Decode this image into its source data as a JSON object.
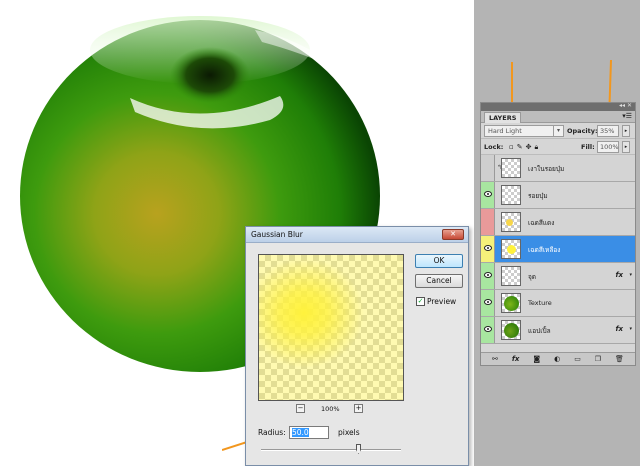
{
  "colors": {
    "apple_green": "#2f9a0d",
    "apple_dark": "#0b4f04",
    "apple_yellow": "#b49a1c",
    "highlight_yellow": "#fff23c",
    "selection_blue": "#3a8ee6",
    "arrow_orange": "#f2971e",
    "workspace_gray": "#b4b4b4"
  },
  "layers_panel": {
    "tab_label": "LAYERS",
    "blend_mode": "Hard Light",
    "opacity_label": "Opacity:",
    "opacity_value": "35%",
    "lock_label": "Lock:",
    "fill_label": "Fill:",
    "fill_value": "100%",
    "layers": [
      {
        "name": "เงาในรอยบุ๋ม",
        "color_tag": "#cfcfcf",
        "thumb": "empty",
        "has_fx": false,
        "selected": false
      },
      {
        "name": "รอยบุ๋ม",
        "color_tag": "#a8e6a0",
        "thumb": "empty",
        "has_fx": false,
        "selected": false
      },
      {
        "name": "เฉดสีแดง",
        "color_tag": "#e99a9a",
        "thumb": "yellow-dot",
        "has_fx": false,
        "selected": false
      },
      {
        "name": "เฉดสีเหลือง",
        "color_tag": "#f5f07a",
        "thumb": "yellow-dot",
        "has_fx": false,
        "selected": true
      },
      {
        "name": "จุด",
        "color_tag": "#a8e6a0",
        "thumb": "empty",
        "has_fx": true,
        "selected": false
      },
      {
        "name": "Texture",
        "color_tag": "#a8e6a0",
        "thumb": "green-apple",
        "has_fx": false,
        "selected": false
      },
      {
        "name": "แอปเปิ้ล",
        "color_tag": "#a8e6a0",
        "thumb": "green-apple",
        "has_fx": true,
        "selected": false
      }
    ],
    "fx_label": "fx",
    "bottom_icons": [
      "link-icon",
      "fx-icon",
      "mask-icon",
      "adjustment-icon",
      "folder-icon",
      "new-layer-icon",
      "trash-icon"
    ]
  },
  "dialog": {
    "title": "Gaussian Blur",
    "close_glyph": "✕",
    "ok_label": "OK",
    "cancel_label": "Cancel",
    "preview_label": "Preview",
    "preview_checked": true,
    "zoom_minus": "−",
    "zoom_level": "100%",
    "zoom_plus": "+",
    "radius_label": "Radius:",
    "radius_value": "50.0",
    "radius_unit": "pixels",
    "slider_position": 0.7
  }
}
